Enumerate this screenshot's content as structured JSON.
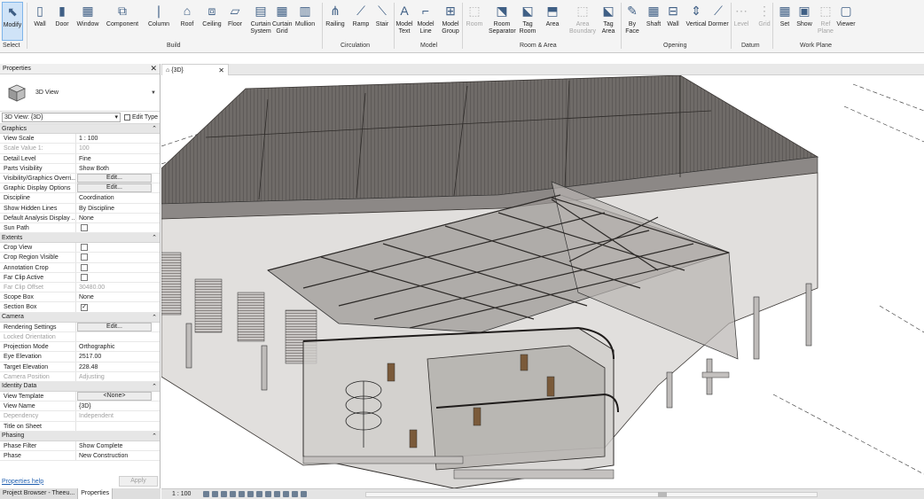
{
  "ribbon": {
    "items": [
      {
        "label": "Modify",
        "icon": "cursor-arrow-icon"
      },
      {
        "label": "Wall",
        "icon": "wall-icon"
      },
      {
        "label": "Door",
        "icon": "door-icon"
      },
      {
        "label": "Window",
        "icon": "window-icon"
      },
      {
        "label": "Component",
        "icon": "component-icon"
      },
      {
        "label": "Column",
        "icon": "column-icon"
      },
      {
        "label": "Roof",
        "icon": "roof-icon"
      },
      {
        "label": "Ceiling",
        "icon": "ceiling-icon"
      },
      {
        "label": "Floor",
        "icon": "floor-icon"
      },
      {
        "label": "Curtain System",
        "icon": "curtain-system-icon"
      },
      {
        "label": "Curtain Grid",
        "icon": "curtain-grid-icon"
      },
      {
        "label": "Mullion",
        "icon": "mullion-icon"
      },
      {
        "label": "Railing",
        "icon": "railing-icon"
      },
      {
        "label": "Ramp",
        "icon": "ramp-icon"
      },
      {
        "label": "Stair",
        "icon": "stair-icon"
      },
      {
        "label": "Model Text",
        "icon": "model-text-icon"
      },
      {
        "label": "Model Line",
        "icon": "model-line-icon"
      },
      {
        "label": "Model Group",
        "icon": "model-group-icon"
      },
      {
        "label": "Room",
        "icon": "room-icon"
      },
      {
        "label": "Room Separator",
        "icon": "room-separator-icon"
      },
      {
        "label": "Tag Room",
        "icon": "tag-room-icon"
      },
      {
        "label": "Area",
        "icon": "area-icon"
      },
      {
        "label": "Area Boundary",
        "icon": "area-boundary-icon"
      },
      {
        "label": "Tag Area",
        "icon": "tag-area-icon"
      },
      {
        "label": "By Face",
        "icon": "by-face-icon"
      },
      {
        "label": "Shaft",
        "icon": "shaft-icon"
      },
      {
        "label": "Wall",
        "icon": "wall-opening-icon"
      },
      {
        "label": "Vertical",
        "icon": "vertical-icon"
      },
      {
        "label": "Dormer",
        "icon": "dormer-icon"
      },
      {
        "label": "Level",
        "icon": "level-icon"
      },
      {
        "label": "Grid",
        "icon": "grid-icon"
      },
      {
        "label": "Set",
        "icon": "set-icon"
      },
      {
        "label": "Show",
        "icon": "show-icon"
      },
      {
        "label": "Ref Plane",
        "icon": "ref-plane-icon"
      },
      {
        "label": "Viewer",
        "icon": "viewer-icon"
      }
    ],
    "panels": {
      "select": "Select",
      "build": "Build",
      "circulation": "Circulation",
      "model": "Model",
      "room_area": "Room & Area",
      "opening": "Opening",
      "datum": "Datum",
      "work_plane": "Work Plane"
    }
  },
  "properties": {
    "title": "Properties",
    "type_name": "3D View",
    "filter_value": "3D View: {3D}",
    "edit_type": "Edit Type",
    "groups": [
      {
        "name": "Graphics",
        "rows": [
          {
            "key": "View Scale",
            "value": "1 : 100"
          },
          {
            "key": "Scale Value    1:",
            "value": "100",
            "disabled": true
          },
          {
            "key": "Detail Level",
            "value": "Fine"
          },
          {
            "key": "Parts Visibility",
            "value": "Show Both"
          },
          {
            "key": "Visibility/Graphics Overri...",
            "value": "Edit...",
            "button": true
          },
          {
            "key": "Graphic Display Options",
            "value": "Edit...",
            "button": true
          },
          {
            "key": "Discipline",
            "value": "Coordination"
          },
          {
            "key": "Show Hidden Lines",
            "value": "By Discipline"
          },
          {
            "key": "Default Analysis Display ...",
            "value": "None"
          },
          {
            "key": "Sun Path",
            "value": "",
            "checkbox": false
          }
        ]
      },
      {
        "name": "Extents",
        "rows": [
          {
            "key": "Crop View",
            "value": "",
            "checkbox": false
          },
          {
            "key": "Crop Region Visible",
            "value": "",
            "checkbox": false
          },
          {
            "key": "Annotation Crop",
            "value": "",
            "checkbox": false
          },
          {
            "key": "Far Clip Active",
            "value": "",
            "checkbox": false
          },
          {
            "key": "Far Clip Offset",
            "value": "30480.00",
            "disabled": true
          },
          {
            "key": "Scope Box",
            "value": "None"
          },
          {
            "key": "Section Box",
            "value": "",
            "checkbox": true
          }
        ]
      },
      {
        "name": "Camera",
        "rows": [
          {
            "key": "Rendering Settings",
            "value": "Edit...",
            "button": true
          },
          {
            "key": "Locked Orientation",
            "value": "",
            "disabled": true
          },
          {
            "key": "Projection Mode",
            "value": "Orthographic"
          },
          {
            "key": "Eye Elevation",
            "value": "2517.00"
          },
          {
            "key": "Target Elevation",
            "value": "228.48"
          },
          {
            "key": "Camera Position",
            "value": "Adjusting",
            "disabled": true
          }
        ]
      },
      {
        "name": "Identity Data",
        "rows": [
          {
            "key": "View Template",
            "value": "<None>",
            "button": true
          },
          {
            "key": "View Name",
            "value": "{3D}"
          },
          {
            "key": "Dependency",
            "value": "Independent",
            "disabled": true
          },
          {
            "key": "Title on Sheet",
            "value": ""
          }
        ]
      },
      {
        "name": "Phasing",
        "rows": [
          {
            "key": "Phase Filter",
            "value": "Show Complete"
          },
          {
            "key": "Phase",
            "value": "New Construction"
          }
        ]
      }
    ],
    "help_link": "Properties help",
    "apply": "Apply"
  },
  "bottom_tabs": [
    "Project Browser - Theeu...",
    "Properties"
  ],
  "view": {
    "tab_title": "{3D}",
    "scale": "1 : 100"
  }
}
